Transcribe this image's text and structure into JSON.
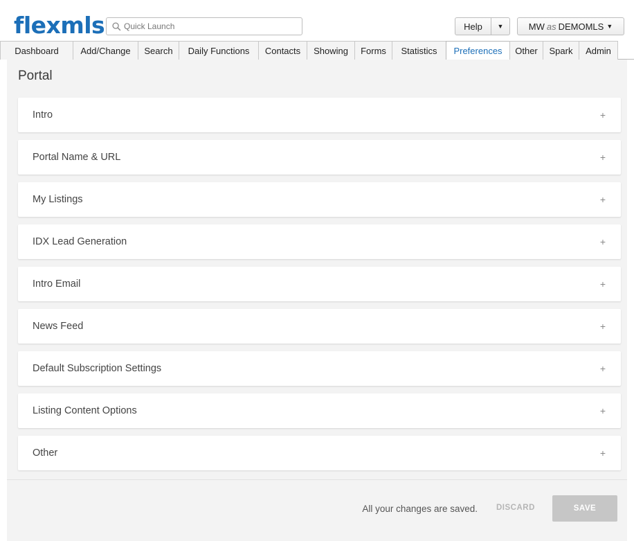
{
  "brand": {
    "logo_text": "flexmls",
    "color": "#1c6fb8"
  },
  "header": {
    "quick_launch_placeholder": "Quick Launch",
    "help_label": "Help",
    "user": {
      "initials": "MW",
      "as": "as",
      "account": "DEMOMLS"
    }
  },
  "tabs": [
    {
      "label": "Dashboard",
      "active": false
    },
    {
      "label": "Add/Change",
      "active": false
    },
    {
      "label": "Search",
      "active": false
    },
    {
      "label": "Daily Functions",
      "active": false
    },
    {
      "label": "Contacts",
      "active": false
    },
    {
      "label": "Showing",
      "active": false
    },
    {
      "label": "Forms",
      "active": false
    },
    {
      "label": "Statistics",
      "active": false
    },
    {
      "label": "Preferences",
      "active": true
    },
    {
      "label": "Other",
      "active": false
    },
    {
      "label": "Spark",
      "active": false
    },
    {
      "label": "Admin",
      "active": false
    }
  ],
  "page": {
    "title": "Portal",
    "panels": [
      {
        "title": "Intro",
        "toggle": "+"
      },
      {
        "title": "Portal Name & URL",
        "toggle": "+"
      },
      {
        "title": "My Listings",
        "toggle": "+"
      },
      {
        "title": "IDX Lead Generation",
        "toggle": "+"
      },
      {
        "title": "Intro Email",
        "toggle": "+"
      },
      {
        "title": "News Feed",
        "toggle": "+"
      },
      {
        "title": "Default Subscription Settings",
        "toggle": "+"
      },
      {
        "title": "Listing Content Options",
        "toggle": "+"
      },
      {
        "title": "Other",
        "toggle": "+"
      }
    ]
  },
  "footer": {
    "status_text": "All your changes are saved.",
    "discard_label": "DISCARD",
    "save_label": "SAVE"
  }
}
